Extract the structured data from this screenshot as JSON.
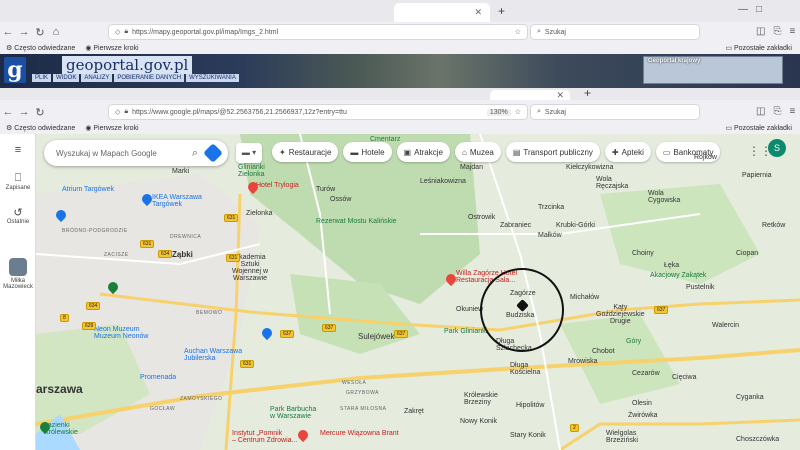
{
  "window1": {
    "tab_title": "",
    "url": "https://mapy.geoportal.gov.pl/imap/Imgs_2.html",
    "search_placeholder": "Szukaj",
    "bookmark_1": "Często odwiedzane",
    "bookmark_2": "Pierwsze kroki",
    "bookmark_other": "Pozostałe zakładki",
    "geoportal_title": "geoportal.gov.pl",
    "geoportal_menu": [
      "PLIK",
      "WIDOK",
      "ANALIZY",
      "POBIERANIE DANYCH",
      "WYSZUKIWANIA"
    ],
    "overview_label": "Geoportal krajowy"
  },
  "window2": {
    "url": "https://www.google.pl/maps/@52.2563756,21.2566937,12z?entry=ttu",
    "zoom": "130%",
    "search_placeholder": "Szukaj",
    "bookmark_1": "Często odwiedzane",
    "bookmark_2": "Pierwsze kroki",
    "bookmark_other": "Pozostałe zakładki"
  },
  "gmaps": {
    "search_placeholder": "Wyszukaj w Mapach Google",
    "sidebar": {
      "saved": "Zapisane",
      "recent": "Ostatnie",
      "recent_place": "Miłka Mazowieck"
    },
    "chips": [
      {
        "icon": "restaurant-icon",
        "glyph": "✦",
        "label": "Restauracje"
      },
      {
        "icon": "hotel-icon",
        "glyph": "▬",
        "label": "Hotele"
      },
      {
        "icon": "attractions-icon",
        "glyph": "▣",
        "label": "Atrakcje"
      },
      {
        "icon": "museum-icon",
        "glyph": "⌂",
        "label": "Muzea"
      },
      {
        "icon": "transit-icon",
        "glyph": "▤",
        "label": "Transport publiczny"
      },
      {
        "icon": "pharmacy-icon",
        "glyph": "✚",
        "label": "Apteki"
      },
      {
        "icon": "atm-icon",
        "glyph": "▭",
        "label": "Bankomaty"
      }
    ],
    "avatar_letter": "S"
  },
  "map_labels": {
    "marki": "Marki",
    "turow": "Turów",
    "ossow": "Ossów",
    "lesniakowizna": "Leśniakowizna",
    "majdan": "Majdan",
    "kielczykowizna": "Kiełczykowizna",
    "wola_reczajska": "Wola\nRęczajska",
    "papiernia": "Papiernia",
    "rojkow": "Rojków",
    "trzcinka": "Trzcinka",
    "wola_cygowska": "Wola\nCygowska",
    "retkow": "Retków",
    "ostrowik": "Ostrowik",
    "zabraniec": "Zabraniec",
    "krubki": "Krubki-Górki",
    "malkow": "Małków",
    "choiny": "Choiny",
    "ciopan": "Ciopan",
    "laka": "Łęka",
    "akacjowy": "Akacjowy Zakątek",
    "pustelnik": "Pustelnik",
    "zielonka": "Zielonka",
    "zabki": "Ząbki",
    "rezerwat": "Rezerwat Mostu Kalińskie",
    "willa": "Willa Zagórze Hotel\nRestauracja Sala...",
    "zagorze": "Zagórze",
    "okuniew": "Okuniew",
    "budziska": "Budziska",
    "michalow": "Michałów",
    "katy": "Kąty\nGoździejewskie\nDrugie",
    "walercin": "Walercin",
    "sulejowek": "Sulejówek",
    "dluga_szlachecka": "Długa\nSzlachecka",
    "chobot": "Chobot",
    "mrowiska": "Mrowiska",
    "dluga_koscielna": "Długa\nKościelna",
    "cezarow": "Cezarów",
    "cieciwa": "Cięciwa",
    "cyganka": "Cyganka",
    "krolewskie": "Królewskie\nBrzeziny",
    "hipolitow": "Hipolitów",
    "olesin": "Olesin",
    "zwirowka": "Żwirówka",
    "zakret": "Zakręt",
    "stary_konik": "Stary Konik",
    "nowy_konik": "Nowy Konik",
    "wielgolas": "Wielgolas\nBrzeziński",
    "choszczowka": "Choszczówka",
    "warszawa": "arszawa",
    "hotel_trylogia": "Hotel Trylogia",
    "ikea": "IKEA Warszawa\nTargówek",
    "atrium": "Atrium Targówek",
    "akademia": "Akademia\nSztuki\nWojennej w\nWarszawie",
    "neon": "Neon Muzeum\nMuzeum Neonów",
    "auchan": "Auchan Warszawa\nJubilerska",
    "promenada": "Promenada",
    "park_glinianki": "Park Glinianki",
    "lazienki": "Łazienki\nKrólewskie",
    "instytut": "Instytut „Pomnik\n– Centrum Zdrowia...",
    "mercure": "Mercure Wiązowna Brant",
    "park_barbuchy": "Park Barbucha\nw Warszawie",
    "cmentarz": "Cmentarz",
    "glinianki": "Glinianki\nZielonka",
    "gory": "Góry",
    "bemowo": "BEMOWO",
    "wesola": "WESOŁA",
    "grzybowa": "GRZYBOWA",
    "stara_milosna": "STARA MIŁOSNA",
    "zamoyskiego": "ZAMOYSKIEGO",
    "zacisze": "ZACISZE",
    "drewnica": "DREWNICA",
    "bródno": "BRÓDNO-PODGRODZIE",
    "gocław": "GOCŁAW"
  },
  "road_numbers": [
    "631",
    "634",
    "637",
    "637",
    "637",
    "631",
    "8",
    "629",
    "634",
    "631",
    "2",
    "631",
    "637"
  ]
}
